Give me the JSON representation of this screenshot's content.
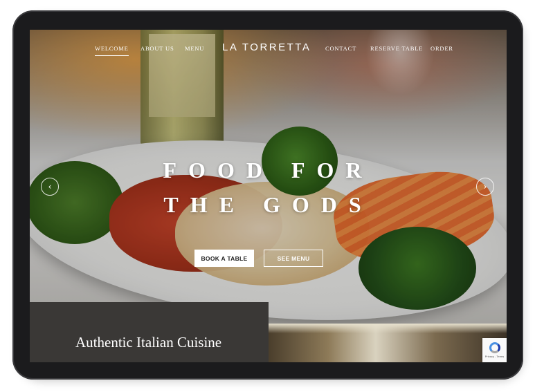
{
  "nav": {
    "items": [
      {
        "label": "WELCOME",
        "active": true
      },
      {
        "label": "ABOUT US",
        "active": false
      },
      {
        "label": "MENU",
        "active": false
      }
    ],
    "logo": "LA TORRETTA",
    "items_right": [
      {
        "label": "CONTACT",
        "active": false
      },
      {
        "label": "RESERVE TABLE",
        "active": false
      },
      {
        "label": "ORDER",
        "active": false
      }
    ]
  },
  "hero": {
    "headline_line1": "FOOD FOR",
    "headline_line2": "THE GODS",
    "primary_cta": "BOOK A TABLE",
    "secondary_cta": "SEE MENU",
    "prev_icon": "chevron-left-icon",
    "next_icon": "chevron-right-icon",
    "prev_glyph": "‹",
    "next_glyph": "›"
  },
  "intro": {
    "title": "Authentic Italian Cuisine"
  },
  "recaptcha": {
    "icon": "recaptcha-icon",
    "text": "Privacy - Terms"
  },
  "colors": {
    "panel": "#3a3836",
    "device_frame": "#1b1b1d",
    "text_light": "#ffffff"
  }
}
